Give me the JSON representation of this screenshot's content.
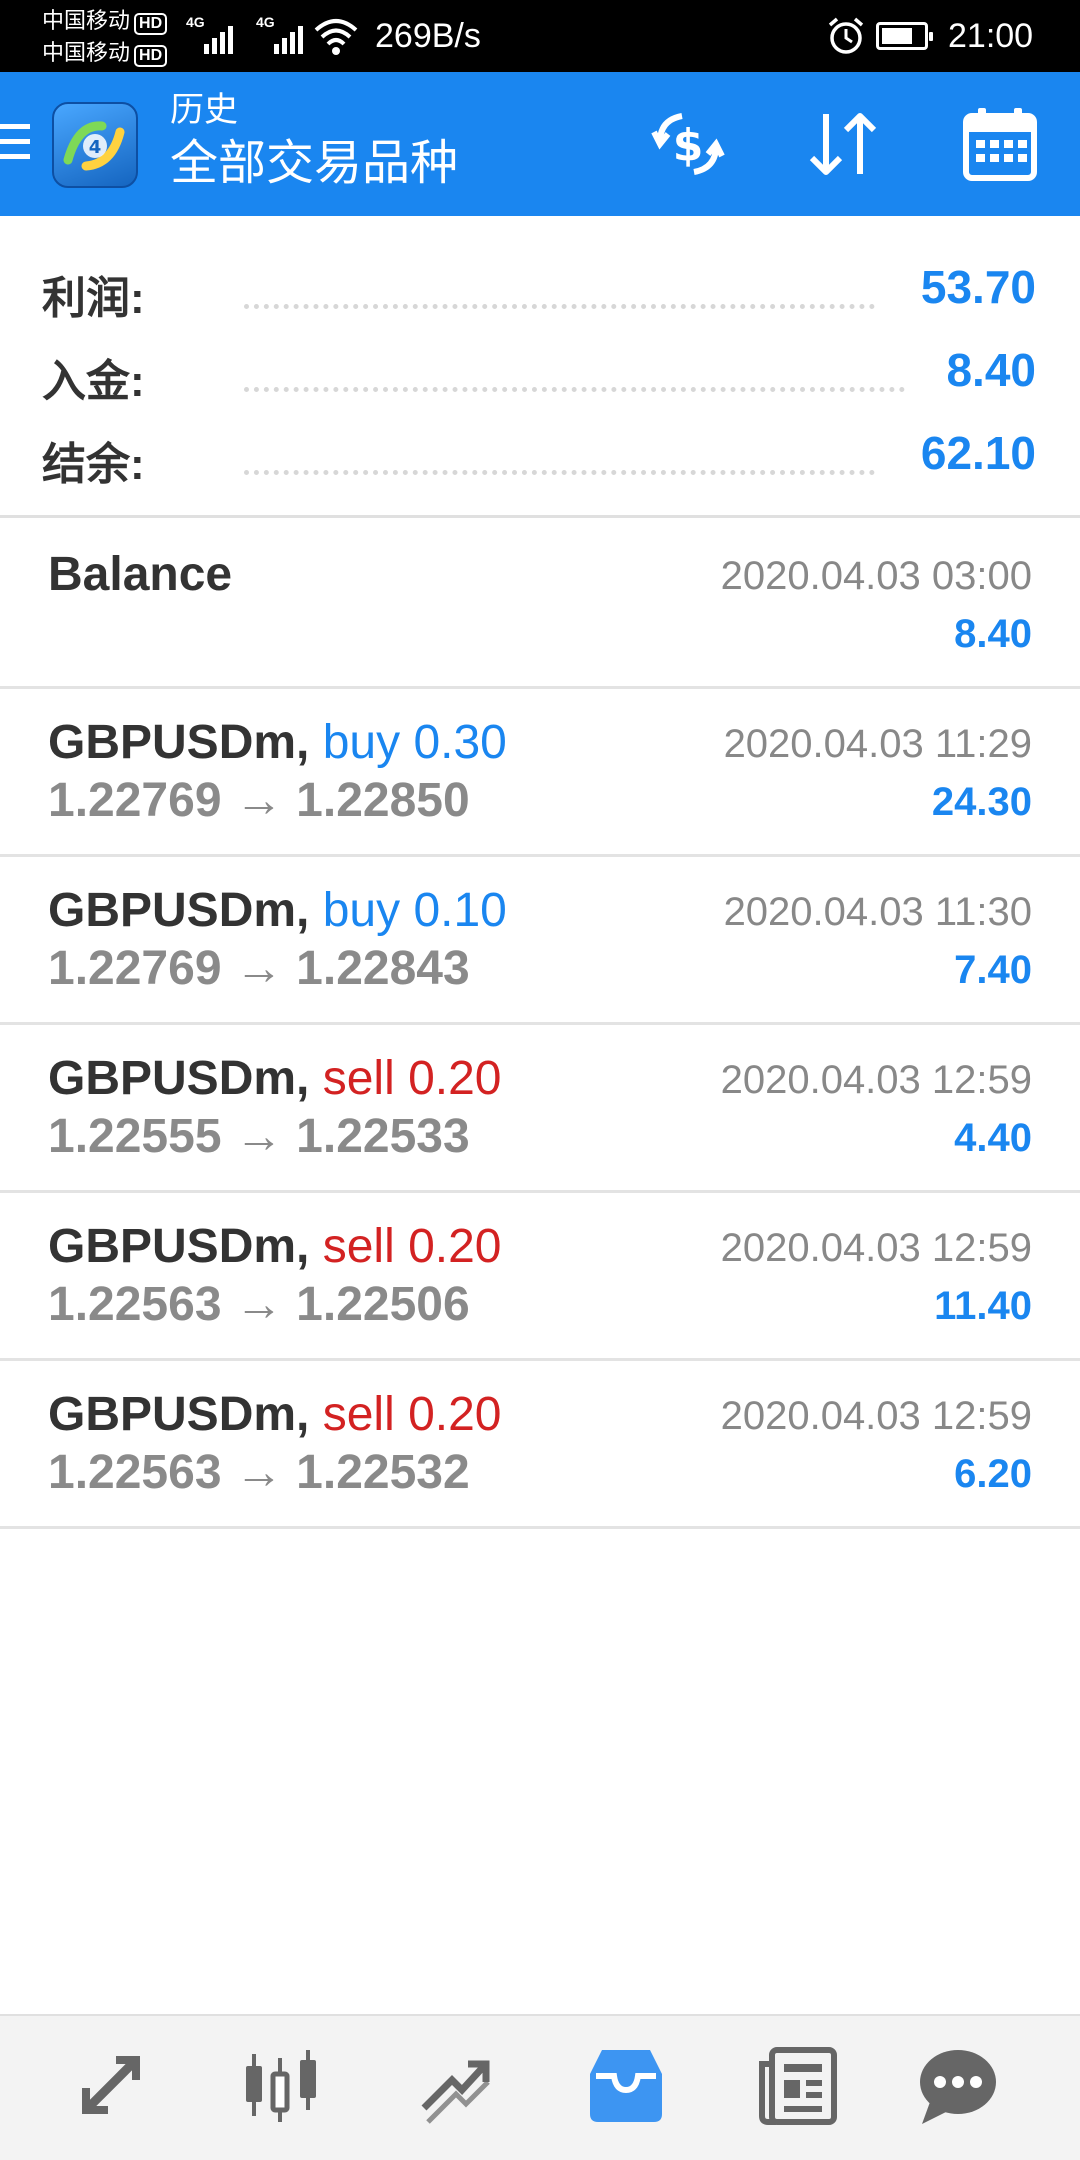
{
  "status_bar": {
    "carrier_1": "中国移动",
    "carrier_2": "中国移动",
    "hd_badge": "HD",
    "network_type": "4G",
    "net_speed": "269B/s",
    "time": "21:00"
  },
  "app_bar": {
    "title": "历史",
    "subtitle": "全部交易品种",
    "icons": [
      "menu-icon",
      "app-logo",
      "currency-exchange-icon",
      "sort-icon",
      "calendar-icon"
    ]
  },
  "summary": {
    "profit_label": "利润:",
    "profit_value": "53.70",
    "deposit_label": "入金:",
    "deposit_value": "8.40",
    "balance_label": "结余:",
    "balance_value": "62.10"
  },
  "balance_entry": {
    "label": "Balance",
    "time": "2020.04.03 03:00",
    "amount": "8.40"
  },
  "deals": [
    {
      "symbol": "GBPUSDm,",
      "side": "buy 0.30",
      "prices": "1.22769 → 1.22850",
      "time": "2020.04.03 11:29",
      "profit": "24.30"
    },
    {
      "symbol": "GBPUSDm,",
      "side": "buy 0.10",
      "prices": "1.22769 → 1.22843",
      "time": "2020.04.03 11:30",
      "profit": "7.40"
    },
    {
      "symbol": "GBPUSDm,",
      "side": "sell 0.20",
      "prices": "1.22555 → 1.22533",
      "time": "2020.04.03 12:59",
      "profit": "4.40"
    },
    {
      "symbol": "GBPUSDm,",
      "side": "sell 0.20",
      "prices": "1.22563 → 1.22506",
      "time": "2020.04.03 12:59",
      "profit": "11.40"
    },
    {
      "symbol": "GBPUSDm,",
      "side": "sell 0.20",
      "prices": "1.22563 → 1.22532",
      "time": "2020.04.03 12:59",
      "profit": "6.20"
    }
  ],
  "colors": {
    "accent": "#1a86f0",
    "sell": "#d32222",
    "muted": "#888888"
  },
  "bottom_nav": {
    "icons": [
      "quotes-icon",
      "chart-icon",
      "trade-icon",
      "history-icon",
      "news-icon",
      "chat-icon"
    ],
    "active": "history-icon"
  }
}
